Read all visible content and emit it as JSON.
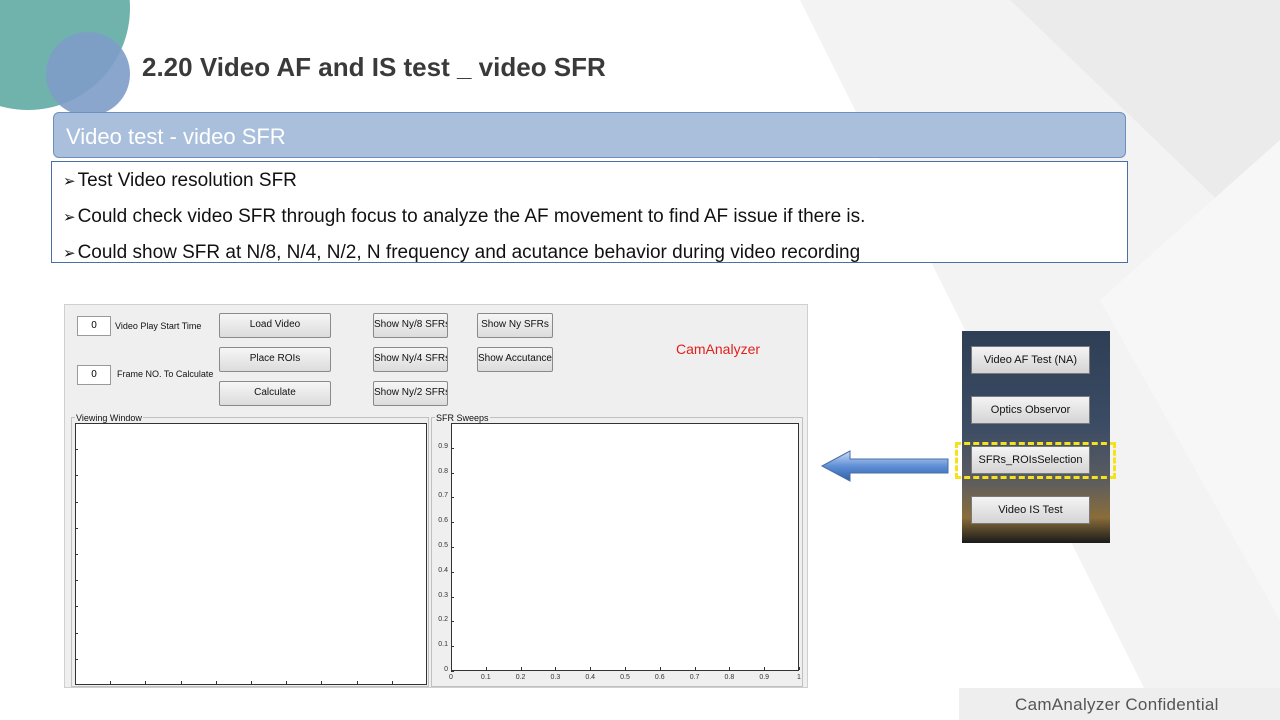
{
  "slide": {
    "title": "2.20  Video AF and IS test _ video SFR",
    "box_header": "Video test  - video SFR",
    "bullets": [
      "Test Video resolution SFR",
      "Could check video SFR through  focus to analyze the AF movement to find AF issue if there is.",
      "Could show SFR at N/8, N/4, N/2, N frequency and acutance behavior during  video recording"
    ],
    "bullet_marker": "➢",
    "footer": "CamAnalyzer  Confidential",
    "colors": {
      "accent_teal": "#6fb3ac",
      "accent_blue": "#7e9cc8",
      "header_fill": "#a9bfdc",
      "highlight": "#f5e21a"
    }
  },
  "gui": {
    "start_time_value": "0",
    "start_time_label": "Video Play Start Time",
    "frame_no_value": "0",
    "frame_no_label": "Frame NO. To Calculate",
    "buttons": {
      "load_video": "Load Video",
      "place_rois": "Place ROIs",
      "calculate": "Calculate",
      "show_ny8": "Show Ny/8 SFRs",
      "show_ny4": "Show Ny/4 SFRs",
      "show_ny2": "Show Ny/2 SFRs",
      "show_ny": "Show Ny SFRs",
      "show_acutances": "Show Accutances"
    },
    "brand": "CamAnalyzer",
    "viewing_window_label": "Viewing Window",
    "sfr_sweeps_label": "SFR Sweeps",
    "y_ticks": [
      "0",
      "0.1",
      "0.2",
      "0.3",
      "0.4",
      "0.5",
      "0.6",
      "0.7",
      "0.8",
      "0.9"
    ],
    "x_ticks": [
      "0",
      "0.1",
      "0.2",
      "0.3",
      "0.4",
      "0.5",
      "0.6",
      "0.7",
      "0.8",
      "0.9",
      "1"
    ]
  },
  "side_menu": {
    "items": [
      "Video AF Test (NA)",
      "Optics Observor",
      "SFRs_ROIsSelection",
      "Video IS Test"
    ],
    "highlighted_index": 2
  }
}
